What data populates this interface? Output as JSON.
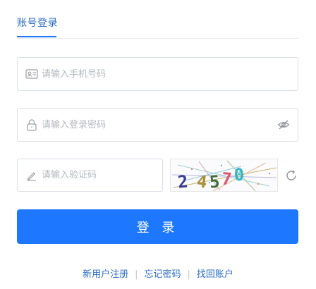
{
  "tabs": [
    {
      "label": "账号登录",
      "active": true
    }
  ],
  "form": {
    "phone_placeholder": "请输入手机号码",
    "password_placeholder": "请输入登录密码",
    "code_placeholder": "请输入验证码"
  },
  "captcha": {
    "digits": [
      "2",
      "4",
      "5",
      "7",
      "0"
    ],
    "colors": [
      "#3b3f8f",
      "#a8913a",
      "#3c6e3e",
      "#d65a73",
      "#2fb7c4"
    ]
  },
  "login_button": "登 录",
  "links": [
    "新用户注册",
    "忘记密码",
    "找回账户"
  ],
  "separator": "|",
  "colors": {
    "primary": "#1e78ff",
    "link": "#2b6cc4",
    "border": "#dcdfe6"
  },
  "icons": [
    "id-card-icon",
    "lock-icon",
    "eye-closed-icon",
    "pencil-icon",
    "refresh-icon"
  ]
}
